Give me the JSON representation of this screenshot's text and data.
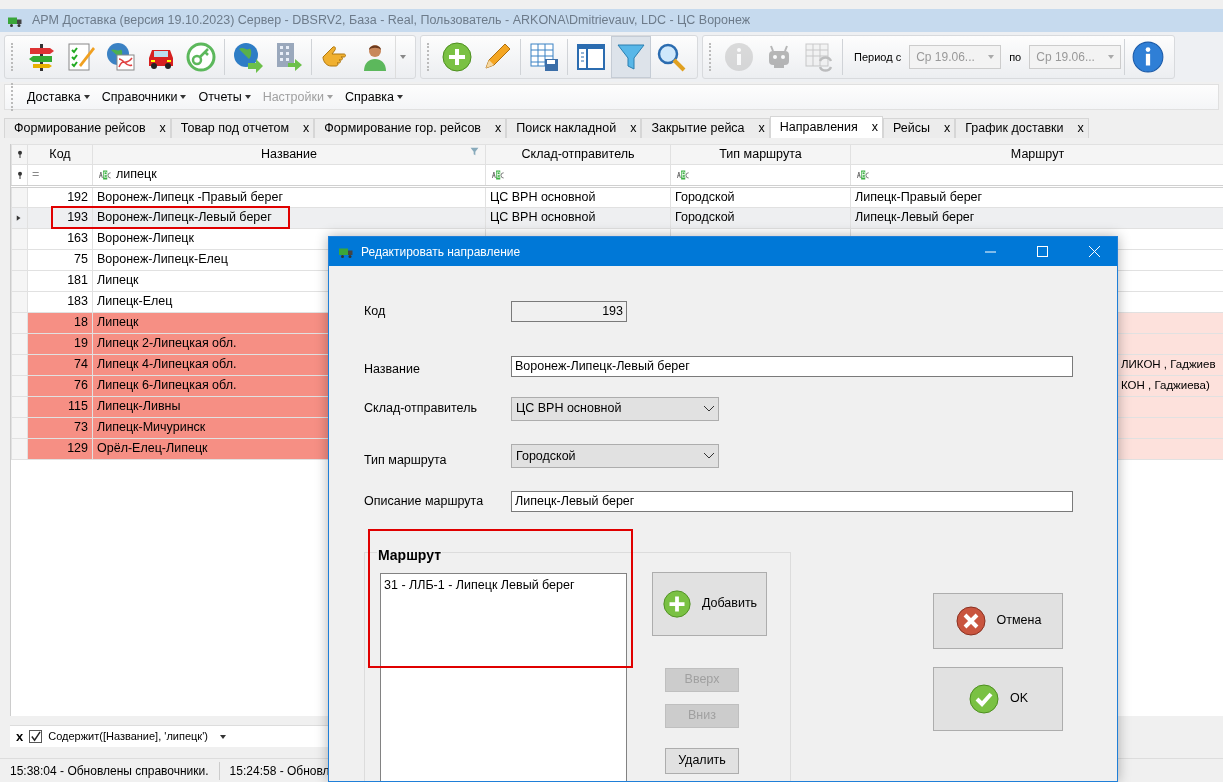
{
  "window": {
    "title": "АРМ Доставка  (версия 19.10.2023) Сервер - DBSRV2, База - Real, Пользователь - ARKONA\\Dmitrievauv, LDC - ЦС Воронеж"
  },
  "toolbar": {
    "buttons": [
      {
        "disabled": false,
        "pressed": false
      },
      {
        "disabled": false,
        "pressed": false
      },
      {
        "disabled": false,
        "pressed": false
      },
      {
        "disabled": false,
        "pressed": false
      },
      {
        "disabled": false,
        "pressed": false
      },
      {
        "disabled": false,
        "pressed": false
      },
      {
        "disabled": false,
        "pressed": false
      },
      {
        "disabled": false,
        "pressed": false
      },
      {
        "disabled": false,
        "pressed": false
      },
      {
        "disabled": false,
        "pressed": false
      },
      {
        "disabled": false,
        "pressed": false
      },
      {
        "disabled": false,
        "pressed": false
      },
      {
        "disabled": false,
        "pressed": false
      },
      {
        "disabled": false,
        "pressed": true
      },
      {
        "disabled": false,
        "pressed": false
      },
      {
        "disabled": true,
        "pressed": false
      },
      {
        "disabled": true,
        "pressed": false
      },
      {
        "disabled": true,
        "pressed": false
      }
    ],
    "period_label": "Период с",
    "period_from": "Ср 19.06...",
    "period_to_label": "по",
    "period_to": "Ср 19.06...",
    "help": {
      "disabled": false
    }
  },
  "menu": [
    {
      "label": "Доставка",
      "disabled": false
    },
    {
      "label": "Справочники",
      "disabled": false
    },
    {
      "label": "Отчеты",
      "disabled": false
    },
    {
      "label": "Настройки",
      "disabled": true
    },
    {
      "label": "Справка",
      "disabled": false
    }
  ],
  "tabs": [
    {
      "label": "Формирование рейсов",
      "close": "x",
      "selected": false
    },
    {
      "label": "Товар под отчетом",
      "close": "x",
      "selected": false
    },
    {
      "label": "Формирование гор. рейсов",
      "close": "x",
      "selected": false
    },
    {
      "label": "Поиск накладной",
      "close": "x",
      "selected": false
    },
    {
      "label": "Закрытие рейса",
      "close": "x",
      "selected": false
    },
    {
      "label": "Направления",
      "close": "x",
      "selected": true
    },
    {
      "label": "Рейсы",
      "close": "x",
      "selected": false
    },
    {
      "label": "График доставки",
      "close": "x",
      "selected": false
    }
  ],
  "grid": {
    "columns": [
      "Код",
      "Название",
      "Склад-отправитель",
      "Тип маршрута",
      "Маршрут"
    ],
    "filter_row": {
      "code_operator": "=",
      "name_filter": "липецк"
    },
    "rows": [
      {
        "code": "192",
        "name": "Воронеж-Липецк -Правый берег",
        "warehouse": "ЦС ВРН основной",
        "route_type": "Городской",
        "route": "Липецк-Правый берег",
        "highlighted": false,
        "selected": false,
        "outlined": false
      },
      {
        "code": "193",
        "name": "Воронеж-Липецк-Левый берег",
        "warehouse": "ЦС ВРН основной",
        "route_type": "Городской",
        "route": "Липецк-Левый берег",
        "highlighted": false,
        "selected": true,
        "outlined": true
      },
      {
        "code": "163",
        "name": "Воронеж-Липецк",
        "highlighted": false,
        "selected": false,
        "outlined": false
      },
      {
        "code": "75",
        "name": "Воронеж-Липецк-Елец",
        "highlighted": false,
        "selected": false,
        "outlined": false
      },
      {
        "code": "181",
        "name": "Липецк",
        "highlighted": false,
        "selected": false,
        "outlined": false
      },
      {
        "code": "183",
        "name": "Липецк-Елец",
        "highlighted": false,
        "selected": false,
        "outlined": false
      },
      {
        "code": "18",
        "name": "Липецк",
        "highlighted": true,
        "selected": false,
        "outlined": false
      },
      {
        "code": "19",
        "name": "Липецк 2-Липецкая обл.",
        "highlighted": true,
        "selected": false,
        "outlined": false
      },
      {
        "code": "74",
        "name": "Липецк 4-Липецкая обл.",
        "route_tail": "ЛИКОН , Гаджиев",
        "highlighted": true,
        "selected": false,
        "outlined": false
      },
      {
        "code": "76",
        "name": "Липецк 6-Липецкая обл.",
        "route_tail": "КОН , Гаджиева)",
        "highlighted": true,
        "selected": false,
        "outlined": false
      },
      {
        "code": "115",
        "name": "Липецк-Ливны",
        "highlighted": true,
        "selected": false,
        "outlined": false
      },
      {
        "code": "73",
        "name": "Липецк-Мичуринск",
        "highlighted": true,
        "selected": false,
        "outlined": false
      },
      {
        "code": "129",
        "name": "Орёл-Елец-Липецк",
        "highlighted": true,
        "selected": false,
        "outlined": false
      }
    ]
  },
  "filter_bar": {
    "close": "x",
    "checked": true,
    "expression": "Содержит([Название], 'липецк')"
  },
  "status_bar": [
    "15:38:04 - Обновлены справочники.",
    "15:24:58 - Обновл"
  ],
  "dialog": {
    "title": "Редактировать направление",
    "fields": [
      {
        "kind": "readonly",
        "label": "Код",
        "value": "193"
      },
      {
        "kind": "text",
        "label": "Название",
        "value": "Воронеж-Липецк-Левый берег"
      },
      {
        "kind": "select",
        "label": "Склад-отправитель",
        "value": "ЦС ВРН основной"
      },
      {
        "kind": "select",
        "label": "Тип маршрута",
        "value": "Городской"
      },
      {
        "kind": "text",
        "label": "Описание маршрута",
        "value": "Липецк-Левый берег"
      }
    ],
    "route_group": {
      "title": "Маршрут",
      "outlined": true,
      "items": [
        "31 - ЛЛБ-1 - Липецк Левый берег"
      ]
    },
    "add_button": "Добавить",
    "up_button": {
      "label": "Вверх",
      "disabled": true
    },
    "down_button": {
      "label": "Вниз",
      "disabled": true
    },
    "delete_button": "Удалить",
    "cancel_button": "Отмена",
    "ok_button": "OK"
  }
}
